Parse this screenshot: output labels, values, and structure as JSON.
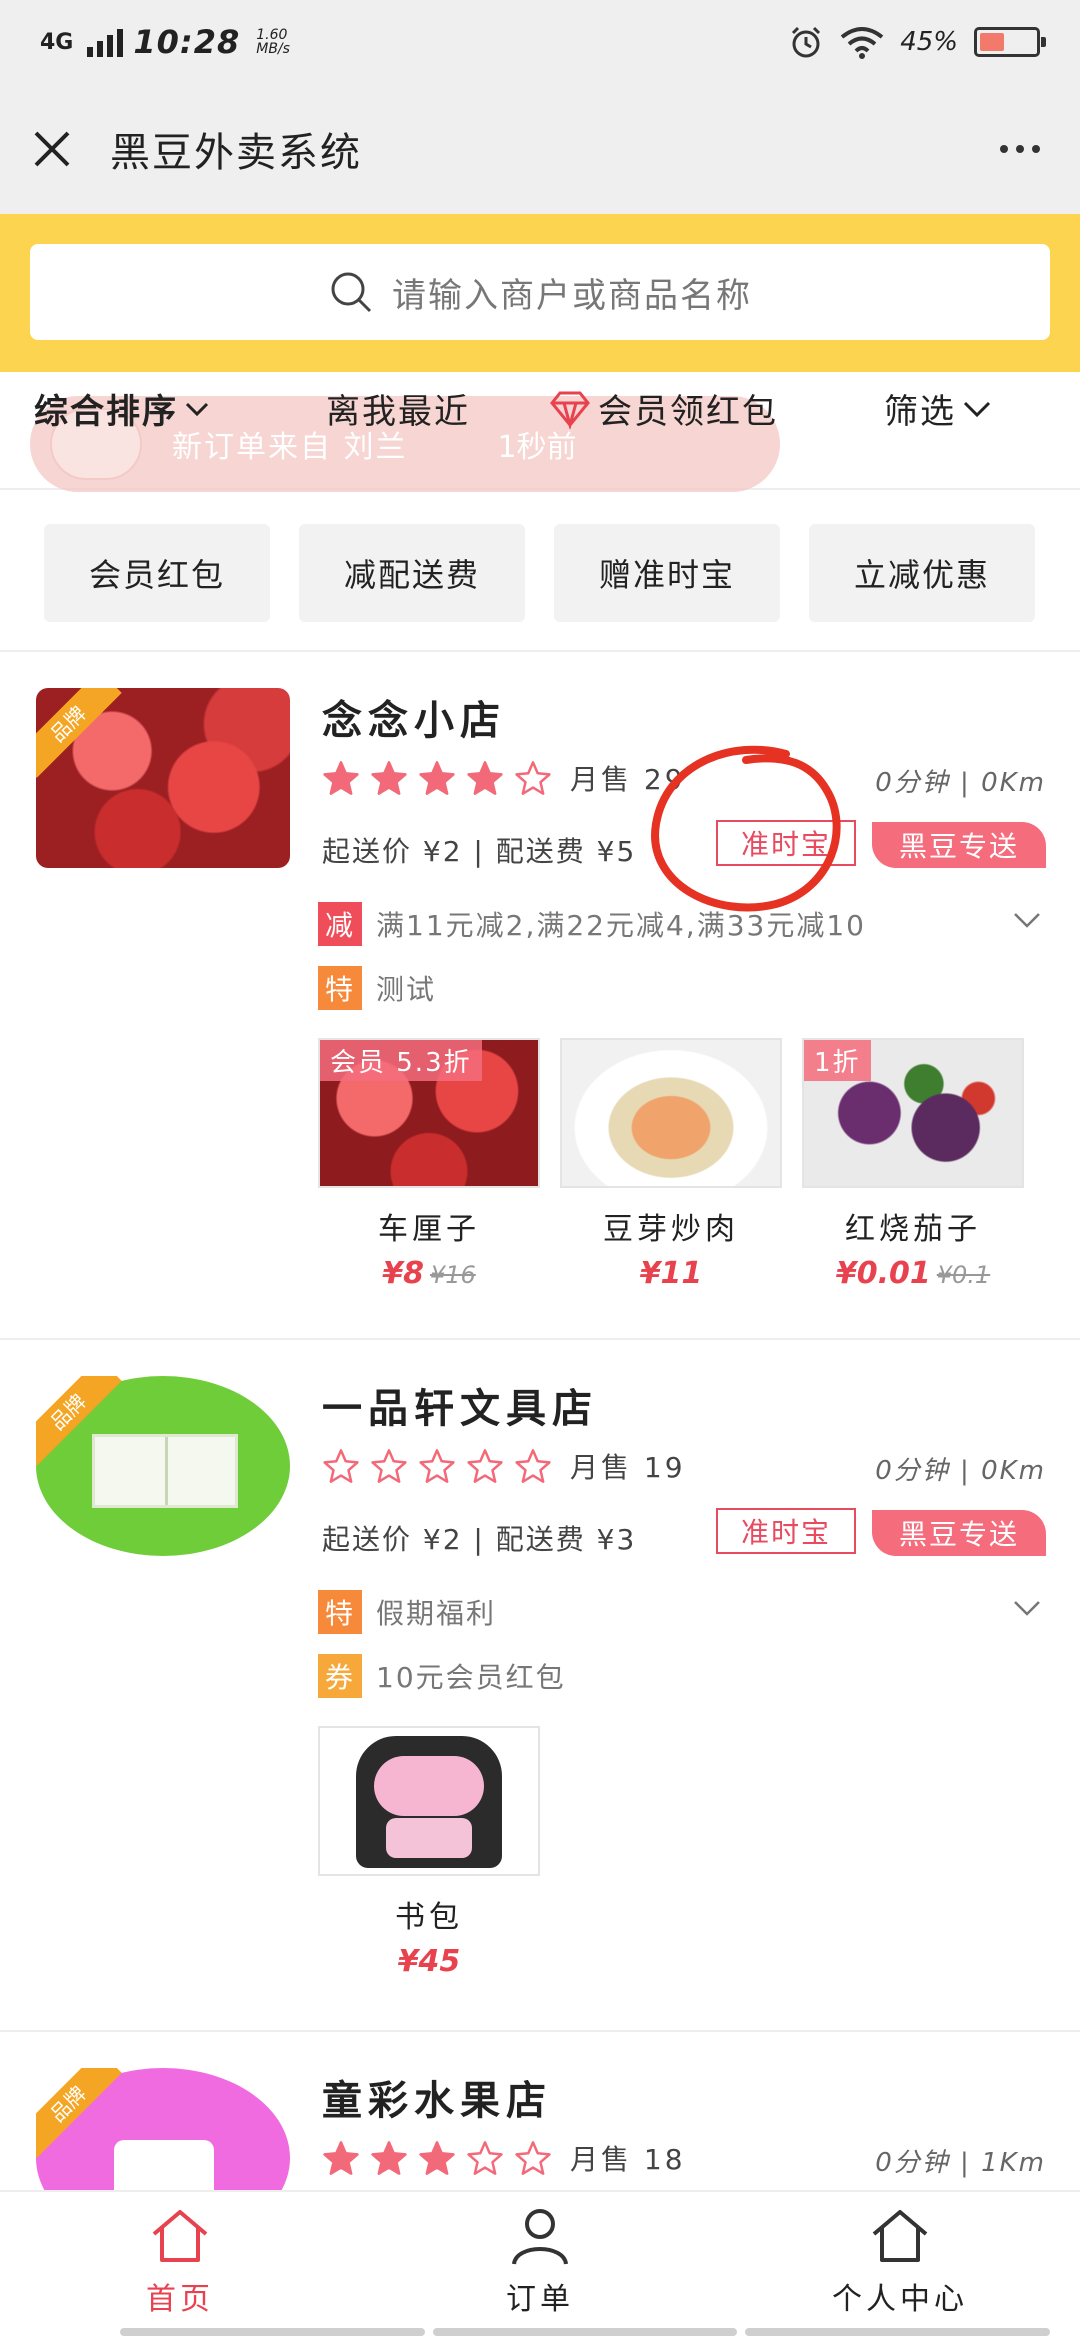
{
  "status_bar": {
    "network": "4G",
    "time": "10:28",
    "speed": "1.60",
    "speed_unit": "MB/s",
    "battery": "45%",
    "battery_level": 0.45
  },
  "header": {
    "title": "黑豆外卖系统",
    "close_icon": "close-icon",
    "more_icon": "more-icon"
  },
  "search": {
    "placeholder": "请输入商户或商品名称"
  },
  "sort_bar": {
    "items": [
      "综合排序",
      "离我最近",
      "会员领红包",
      "筛选"
    ],
    "toast_text": "新订单来自 刘兰",
    "toast_time": "1秒前"
  },
  "tags": [
    "会员红包",
    "减配送费",
    "赠准时宝",
    "立减优惠"
  ],
  "shops": [
    {
      "name": "念念小店",
      "rating": 4,
      "sales_label": "月售",
      "sales": "29",
      "time": "0分钟",
      "distance": "0Km",
      "min_order": "起送价 ¥2",
      "delivery_fee": "配送费 ¥5",
      "badge_ontime": "准时宝",
      "badge_delivery": "黑豆专送",
      "brand": "品牌",
      "promos": [
        {
          "tag": "减",
          "text": "满11元减2,满22元减4,满33元减10",
          "color": "#f04d5b"
        },
        {
          "tag": "特",
          "text": "测试",
          "color": "#f7893a"
        }
      ],
      "products": [
        {
          "name": "车厘子",
          "price": "¥8",
          "old_price": "¥16",
          "discount": "会员 5.3折"
        },
        {
          "name": "豆芽炒肉",
          "price": "¥11",
          "old_price": "",
          "discount": ""
        },
        {
          "name": "红烧茄子",
          "price": "¥0.01",
          "old_price": "¥0.1",
          "discount": "1折"
        }
      ]
    },
    {
      "name": "一品轩文具店",
      "rating": 0,
      "sales_label": "月售",
      "sales": "19",
      "time": "0分钟",
      "distance": "0Km",
      "min_order": "起送价 ¥2",
      "delivery_fee": "配送费 ¥3",
      "badge_ontime": "准时宝",
      "badge_delivery": "黑豆专送",
      "brand": "品牌",
      "promos": [
        {
          "tag": "特",
          "text": "假期福利",
          "color": "#f7893a"
        },
        {
          "tag": "券",
          "text": "10元会员红包",
          "color": "#f7a83a"
        }
      ],
      "products": [
        {
          "name": "书包",
          "price": "¥45",
          "old_price": "",
          "discount": ""
        }
      ]
    },
    {
      "name": "童彩水果店",
      "rating": 3,
      "sales_label": "月售",
      "sales": "18",
      "time": "0分钟",
      "distance": "1Km",
      "brand": "品牌"
    }
  ],
  "bottom_nav": [
    "首页",
    "订单",
    "个人中心"
  ],
  "colors": {
    "accent": "#e8424f",
    "search_band": "#fdd44f",
    "star": "#f26a7a"
  }
}
